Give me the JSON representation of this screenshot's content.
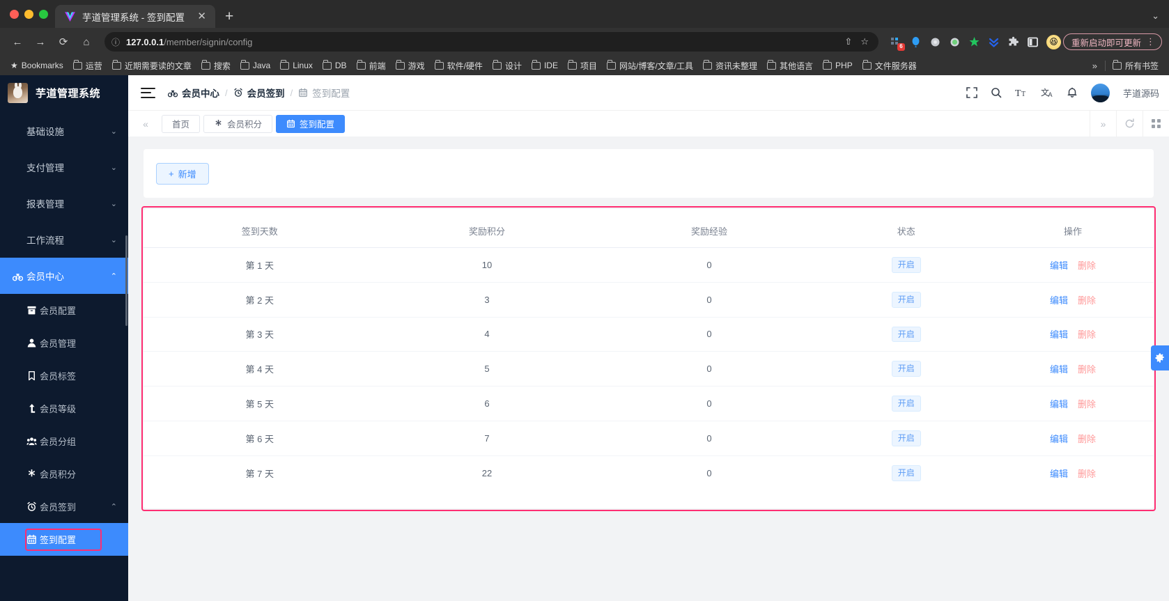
{
  "browser": {
    "tab": {
      "title": "芋道管理系统 - 签到配置",
      "favicon": "vite-logo-icon",
      "close": "✕"
    },
    "new_tab": "+",
    "window_chevron": "⌄",
    "nav": {
      "back": "←",
      "forward": "→",
      "reload": "⟳",
      "home": "⌂"
    },
    "omnibox": {
      "info_icon": "ⓘ",
      "host": "127.0.0.1",
      "path": "/member/signin/config",
      "share_icon": "⇧",
      "star_icon": "☆"
    },
    "extensions": [
      {
        "name": "tasks-extension",
        "badge": "6"
      },
      {
        "name": "balloon-extension",
        "badge": ""
      },
      {
        "name": "grey-circle-extension",
        "badge": ""
      },
      {
        "name": "green-circle-extension",
        "badge": ""
      },
      {
        "name": "green-star-extension",
        "badge": ""
      },
      {
        "name": "double-chevron-down-extension",
        "badge": ""
      },
      {
        "name": "puzzle-piece-extension",
        "badge": ""
      },
      {
        "name": "side-panel-extension",
        "badge": ""
      }
    ],
    "profile_emoji": "😆",
    "update_button": {
      "label": "重新启动即可更新",
      "kebab": "⋮"
    },
    "bookmarks_star": "★",
    "bookmarks": [
      "Bookmarks",
      "运营",
      "近期需要读的文章",
      "搜索",
      "Java",
      "Linux",
      "DB",
      "前端",
      "游戏",
      "软件/硬件",
      "设计",
      "IDE",
      "项目",
      "网站/博客/文章/工具",
      "资讯未整理",
      "其他语言",
      "PHP",
      "文件服务器"
    ],
    "bookmarks_overflow": "»",
    "all_bookmarks": "所有书签"
  },
  "sidebar": {
    "logo_label": "芋道管理系统",
    "items": [
      {
        "label": "基础设施",
        "icon": "",
        "arrow": "⌄",
        "level": "top",
        "active": false
      },
      {
        "label": "支付管理",
        "icon": "",
        "arrow": "⌄",
        "level": "top",
        "active": false
      },
      {
        "label": "报表管理",
        "icon": "",
        "arrow": "⌄",
        "level": "top",
        "active": false
      },
      {
        "label": "工作流程",
        "icon": "",
        "arrow": "⌄",
        "level": "top",
        "active": false
      },
      {
        "label": "会员中心",
        "icon": "bike-icon",
        "arrow": "⌃",
        "level": "top",
        "active": true
      },
      {
        "label": "会员配置",
        "icon": "box-icon",
        "arrow": "",
        "level": "sub",
        "active": false
      },
      {
        "label": "会员管理",
        "icon": "user-icon",
        "arrow": "",
        "level": "sub",
        "active": false
      },
      {
        "label": "会员标签",
        "icon": "bookmark-icon",
        "arrow": "",
        "level": "sub",
        "active": false
      },
      {
        "label": "会员等级",
        "icon": "arrow-up-icon",
        "arrow": "",
        "level": "sub",
        "active": false
      },
      {
        "label": "会员分组",
        "icon": "group-icon",
        "arrow": "",
        "level": "sub",
        "active": false
      },
      {
        "label": "会员积分",
        "icon": "asterisk-icon",
        "arrow": "",
        "level": "sub",
        "active": false
      },
      {
        "label": "会员签到",
        "icon": "alarm-clock-icon",
        "arrow": "⌃",
        "level": "sub",
        "active": false
      },
      {
        "label": "签到配置",
        "icon": "calendar-icon",
        "arrow": "",
        "level": "sub",
        "active": true
      }
    ]
  },
  "topbar": {
    "menu_toggle": "hamburger-icon",
    "breadcrumb": [
      {
        "label": "会员中心",
        "icon": "bike-icon"
      },
      {
        "label": "会员签到",
        "icon": "alarm-clock-icon"
      },
      {
        "label": "签到配置",
        "icon": "calendar-icon"
      }
    ],
    "separator": "/",
    "icons": [
      "fullscreen-icon",
      "search-icon",
      "font-size-icon",
      "translate-icon",
      "bell-icon"
    ],
    "user_name": "芋道源码"
  },
  "tabbar": {
    "collapse_left": "«",
    "tabs": [
      {
        "label": "首页",
        "icon": "",
        "active": false
      },
      {
        "label": "会员积分",
        "icon": "asterisk-icon",
        "active": false
      },
      {
        "label": "签到配置",
        "icon": "calendar-icon",
        "active": true
      }
    ],
    "collapse_right": "»",
    "refresh": "refresh-icon",
    "grid": "grid-icon"
  },
  "toolbar": {
    "add_label": "新增",
    "add_icon": "+"
  },
  "table": {
    "columns": [
      "签到天数",
      "奖励积分",
      "奖励经验",
      "状态",
      "操作"
    ],
    "rows": [
      {
        "day": "第 1 天",
        "points": "10",
        "exp": "0",
        "status": "开启",
        "edit": "编辑",
        "delete": "删除"
      },
      {
        "day": "第 2 天",
        "points": "3",
        "exp": "0",
        "status": "开启",
        "edit": "编辑",
        "delete": "删除"
      },
      {
        "day": "第 3 天",
        "points": "4",
        "exp": "0",
        "status": "开启",
        "edit": "编辑",
        "delete": "删除"
      },
      {
        "day": "第 4 天",
        "points": "5",
        "exp": "0",
        "status": "开启",
        "edit": "编辑",
        "delete": "删除"
      },
      {
        "day": "第 5 天",
        "points": "6",
        "exp": "0",
        "status": "开启",
        "edit": "编辑",
        "delete": "删除"
      },
      {
        "day": "第 6 天",
        "points": "7",
        "exp": "0",
        "status": "开启",
        "edit": "编辑",
        "delete": "删除"
      },
      {
        "day": "第 7 天",
        "points": "22",
        "exp": "0",
        "status": "开启",
        "edit": "编辑",
        "delete": "删除"
      }
    ]
  },
  "float_settings": {
    "icon": "gear-icon"
  },
  "colors": {
    "accent": "#3d8bfd",
    "sidebar_bg": "#0d1a2e",
    "annotation": "#ff2d72",
    "delete_link": "#ff9999",
    "tag_bg": "#ecf5ff"
  }
}
